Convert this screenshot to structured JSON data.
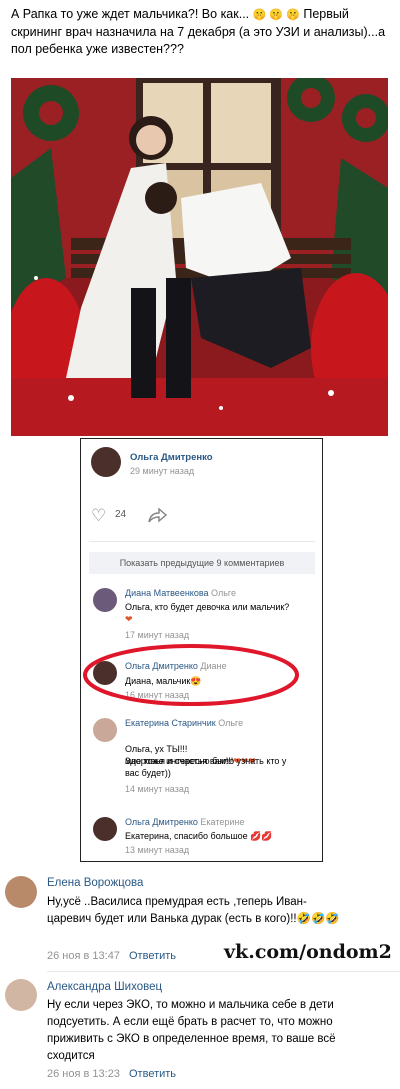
{
  "post": {
    "text": "А Рапка то уже ждет мальчика?! Во как...",
    "emoji": "🤫 🤫 🤫",
    "text2": "Первый скрининг врач назначила на 7 декабря (а это УЗИ и анализы)...а пол ребенка уже известен???"
  },
  "screenshot": {
    "post_author": "Ольга Дмитренко",
    "post_time": "29 минут назад",
    "likes_count": "24",
    "show_prev": "Показать предыдущие 9 комментариев",
    "comments": [
      {
        "author": "Диана Матвеенкова",
        "to": "Ольге",
        "text": "Ольга, кто будет девочка или мальчик?",
        "emoji": "❤",
        "time": "17 минут назад"
      },
      {
        "author": "Ольга Дмитренко",
        "to": "Диане",
        "text": "Диана, мальчик",
        "emoji": "😍",
        "time": "16 минут назад"
      },
      {
        "author": "Екатерина Старинчик",
        "to": "Ольге",
        "text": "Ольга, ух ТЫ!!!\nЗдоровья и счастья вам!!!",
        "emoji": "❤❤❤",
        "text2": "мне тоже интересно было узнать кто у вас будет))",
        "time": "14 минут назад"
      },
      {
        "author": "Ольга Дмитренко",
        "to": "Екатерине",
        "text": "Екатерина, спасибо большое",
        "emoji": "💋💋",
        "time": "13 минут назад"
      }
    ]
  },
  "comments": [
    {
      "author": "Елена Ворожцова",
      "text": "Ну,усё ..Василиса премудрая есть ,теперь Иван-царевич будет или Ванька дурак (есть в кого)!!",
      "emoji": "🤣🤣🤣",
      "date": "26 ноя в 13:47",
      "reply": "Ответить"
    },
    {
      "author": "Александра Шиховец",
      "text": "Ну если через ЭКО, то можно и мальчика себе в дети подсуетить. А если ещё брать в расчет то, что можно приживить с ЭКО в определенное время, то ваше всё сходится",
      "date": "26 ноя в 13:23",
      "reply": "Ответить"
    }
  ],
  "watermark": "vk.com/ondom2",
  "colors": {
    "link": "#2a5885",
    "muted": "#939393",
    "highlight": "#e0162b",
    "heart": "#e2552b"
  }
}
